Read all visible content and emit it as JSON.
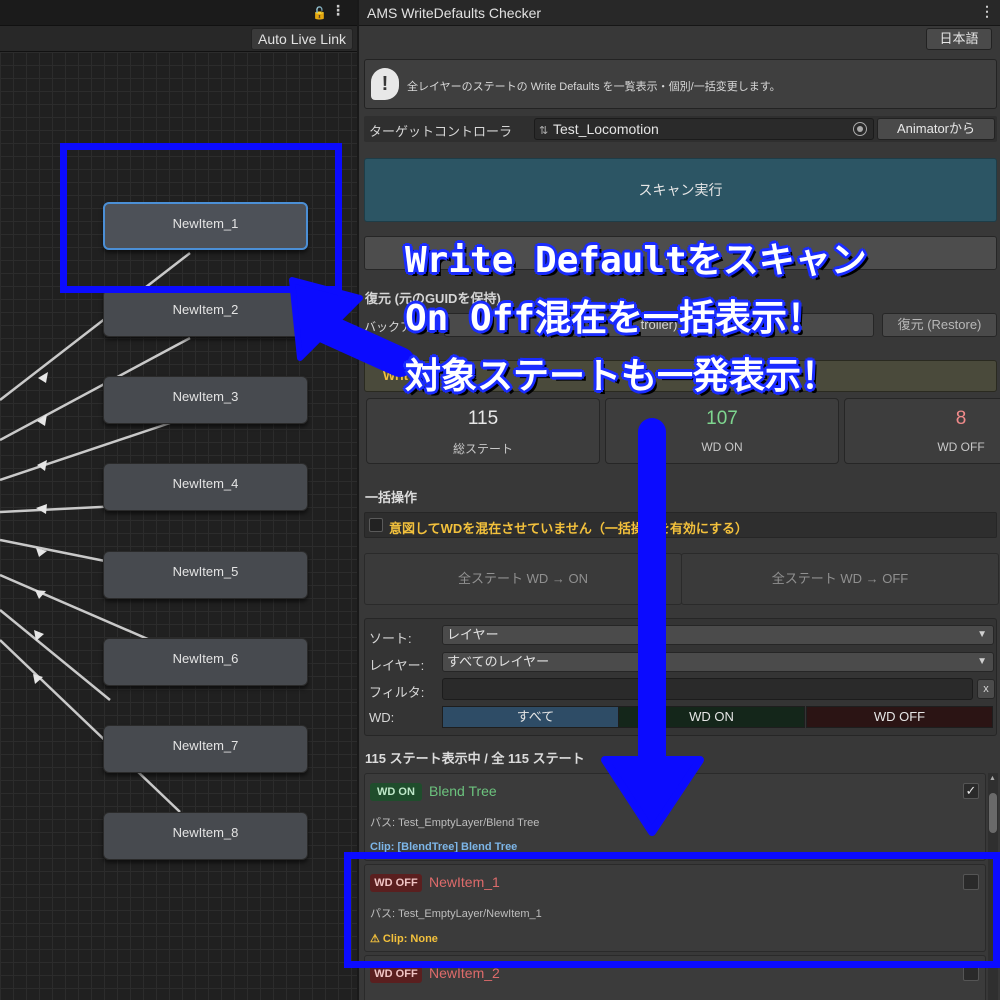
{
  "graph": {
    "toolbar_button": "Auto Live Link",
    "nodes": [
      "NewItem_1",
      "NewItem_2",
      "NewItem_3",
      "NewItem_4",
      "NewItem_5",
      "NewItem_6",
      "NewItem_7",
      "NewItem_8"
    ]
  },
  "panel": {
    "title": "AMS WriteDefaults Checker",
    "language_button": "日本語",
    "info_text": "全レイヤーのステートの Write Defaults を一覧表示・個別/一括変更します。",
    "target_label": "ターゲットコントローラ",
    "target_value": "Test_Locomotion",
    "from_animator_button": "Animatorから",
    "scan_button": "スキャン実行",
    "backup_button_visible": "バ",
    "restore_title_visible": "復元 (元のGUIDを保持)",
    "backup_label_visible": "バックアップ",
    "restore_field_visible": "troller)",
    "restore_button_visible": "復元 (Restore)",
    "warn_text_visible": "Writ",
    "stats": [
      {
        "value": "115",
        "label": "総ステート",
        "color": "#e8e8e8"
      },
      {
        "value": "107",
        "label": "WD ON",
        "color": "#7ed68f"
      },
      {
        "value": "8",
        "label": "WD OFF",
        "color": "#f08a8a"
      }
    ],
    "bulk_title": "一括操作",
    "mix_label": "意図してWDを混在させていません（一括操作を有効にする）",
    "bulk_on": "全ステート WD → ON",
    "bulk_off": "全ステート WD → OFF",
    "filters": {
      "sort_label": "ソート:",
      "sort_value": "レイヤー",
      "layer_label": "レイヤー:",
      "layer_value": "すべてのレイヤー",
      "filter_label": "フィルタ:",
      "clear": "x",
      "wd_label": "WD:",
      "wd_all": "すべて",
      "wd_on": "WD ON",
      "wd_off": "WD OFF"
    },
    "count_line": "115 ステート表示中 / 全 115 ステート",
    "states": [
      {
        "badge": "WD ON",
        "name": "Blend Tree",
        "path": "パス: Test_EmptyLayer/Blend Tree",
        "clip": "Clip: [BlendTree] Blend Tree",
        "checked": "✓"
      },
      {
        "badge": "WD OFF",
        "name": "NewItem_1",
        "path": "パス: Test_EmptyLayer/NewItem_1",
        "clip": "⚠ Clip: None",
        "checked": ""
      },
      {
        "badge": "WD OFF",
        "name": "NewItem_2",
        "path": "",
        "clip": "",
        "checked": ""
      }
    ]
  },
  "callout": {
    "line1": "Write Defaultをスキャン",
    "line2": "On Off混在を一括表示！",
    "line3": "対象ステートも一発表示！"
  },
  "colors": {
    "highlight": "#0b0bff",
    "scan_button": "#2c5564",
    "warning": "#f3c13c"
  }
}
